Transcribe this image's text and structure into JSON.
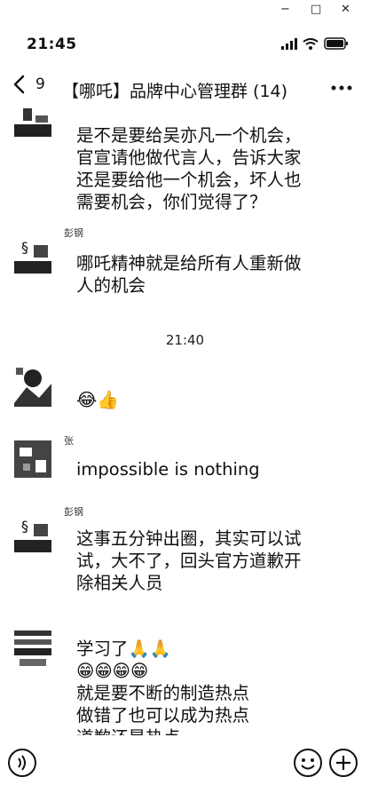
{
  "window_controls": {
    "minimize": "−",
    "maximize": "□",
    "close": "✕"
  },
  "status_bar": {
    "time": "21:45"
  },
  "nav": {
    "back_count": "9",
    "title": "【哪吒】品牌中心管理群 (14)"
  },
  "messages": [
    {
      "sender": "",
      "text_lines": [
        "是不是要给吴亦凡一个机会，",
        "官宣请他做代言人，告诉大家",
        "还是要给他一个机会，坏人也",
        "需要机会，你们觉得了？"
      ]
    },
    {
      "sender": "彭钢",
      "text_lines": [
        "哪吒精神就是给所有人重新做",
        "人的机会"
      ]
    },
    {
      "time_divider": "21:40"
    },
    {
      "sender": "",
      "text_lines": [
        "😂👍"
      ]
    },
    {
      "sender": "张",
      "text_lines": [
        "impossible is nothing"
      ]
    },
    {
      "sender": "彭钢",
      "text_lines": [
        "这事五分钟出圈，其实可以试",
        "试，大不了，回头官方道歉开",
        "除相关人员"
      ]
    },
    {
      "sender": "",
      "text_lines": [
        "学习了🙏🙏",
        "😁😁😁😁",
        "就是要不断的制造热点",
        "做错了也可以成为热点",
        "道歉还是热点"
      ]
    }
  ],
  "icons": {
    "back": "chevron-left-icon",
    "more": "more-icon",
    "voice": "voice-icon",
    "emoji": "emoji-icon",
    "add": "add-icon"
  }
}
